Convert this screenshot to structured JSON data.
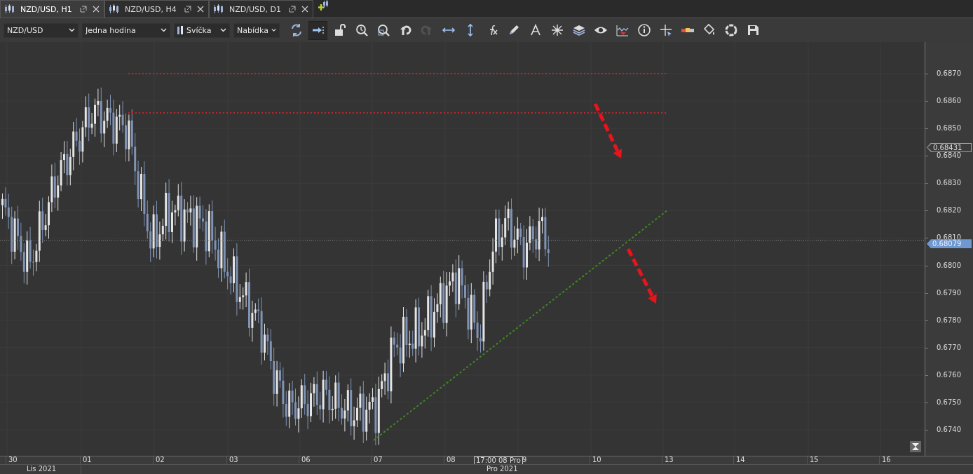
{
  "tabs": [
    {
      "label": "NZD/USD, H1",
      "selected": true
    },
    {
      "label": "NZD/USD, H4",
      "selected": false
    },
    {
      "label": "NZD/USD, D1",
      "selected": false
    }
  ],
  "toolbar": {
    "dropdowns": [
      {
        "kind": "symbol",
        "value": "NZD/USD"
      },
      {
        "kind": "period",
        "value": "Jedna hodina"
      },
      {
        "kind": "chart-type",
        "value": "Svíčka"
      },
      {
        "kind": "price-side",
        "value": "Nabídka"
      }
    ],
    "tools": [
      {
        "kind": "refresh",
        "selected": false,
        "disabled": false
      },
      {
        "kind": "shift",
        "selected": true,
        "disabled": false
      },
      {
        "kind": "lock",
        "selected": false,
        "disabled": false
      },
      {
        "kind": "zoom-in",
        "selected": false,
        "disabled": false
      },
      {
        "kind": "zoom-out",
        "selected": false,
        "disabled": false
      },
      {
        "kind": "undo",
        "selected": false,
        "disabled": false
      },
      {
        "kind": "redo",
        "selected": false,
        "disabled": true
      },
      {
        "kind": "horizontal",
        "selected": false,
        "disabled": false
      },
      {
        "kind": "vertical",
        "selected": false,
        "disabled": false
      },
      {
        "kind": "function",
        "selected": false,
        "disabled": false
      },
      {
        "kind": "pencil",
        "selected": false,
        "disabled": false
      },
      {
        "kind": "text",
        "selected": false,
        "disabled": false
      },
      {
        "kind": "objects",
        "selected": false,
        "disabled": false
      },
      {
        "kind": "layers",
        "selected": false,
        "disabled": false
      },
      {
        "kind": "eye",
        "selected": false,
        "disabled": false
      },
      {
        "kind": "indicator",
        "selected": false,
        "disabled": false
      },
      {
        "kind": "info",
        "selected": false,
        "disabled": false
      },
      {
        "kind": "crosshair",
        "selected": false,
        "disabled": false
      },
      {
        "kind": "colors",
        "selected": false,
        "disabled": false
      },
      {
        "kind": "fill",
        "selected": false,
        "disabled": false
      },
      {
        "kind": "ring",
        "selected": false,
        "disabled": false
      },
      {
        "kind": "save",
        "selected": false,
        "disabled": false
      }
    ]
  },
  "chart": {
    "price_ticks": [
      "0.6870",
      "0.6860",
      "0.6850",
      "0.6840",
      "0.6830",
      "0.6820",
      "0.6810",
      "0.6800",
      "0.6790",
      "0.6780",
      "0.6770",
      "0.6760",
      "0.6750",
      "0.6740"
    ],
    "price_markers": [
      {
        "kind": "outline",
        "label": "0.68431"
      },
      {
        "kind": "current",
        "label": "0.68079"
      }
    ],
    "time_labels": [
      "30",
      "01",
      "02",
      "03",
      "06",
      "07",
      "08",
      "9",
      "10",
      "13",
      "14",
      "15",
      "16"
    ],
    "crosshair_label": "17:00 08 Pro",
    "month_labels": [
      "Lis 2021",
      "Pro 2021"
    ]
  }
}
